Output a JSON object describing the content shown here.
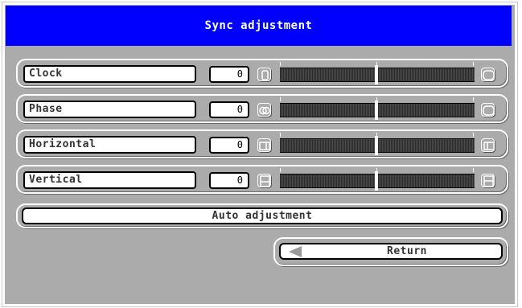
{
  "window": {
    "title": "Sync adjustment",
    "title_bg": "#0000ff",
    "panel_bg": "#ababab"
  },
  "adjustments": [
    {
      "label": "Clock",
      "value": "0",
      "level": 0.5,
      "left_icon": "clock-narrow-icon",
      "right_icon": "clock-wide-icon"
    },
    {
      "label": "Phase",
      "value": "0",
      "level": 0.5,
      "left_icon": "phase-left-icon",
      "right_icon": "phase-right-icon"
    },
    {
      "label": "Horizontal",
      "value": "0",
      "level": 0.5,
      "left_icon": "move-left-icon",
      "right_icon": "move-right-icon"
    },
    {
      "label": "Vertical",
      "value": "0",
      "level": 0.5,
      "left_icon": "move-down-icon",
      "right_icon": "move-up-icon"
    }
  ],
  "auto_adjustment": {
    "label": "Auto adjustment"
  },
  "return_button": {
    "label": "Return",
    "icon": "back-arrow-icon"
  }
}
